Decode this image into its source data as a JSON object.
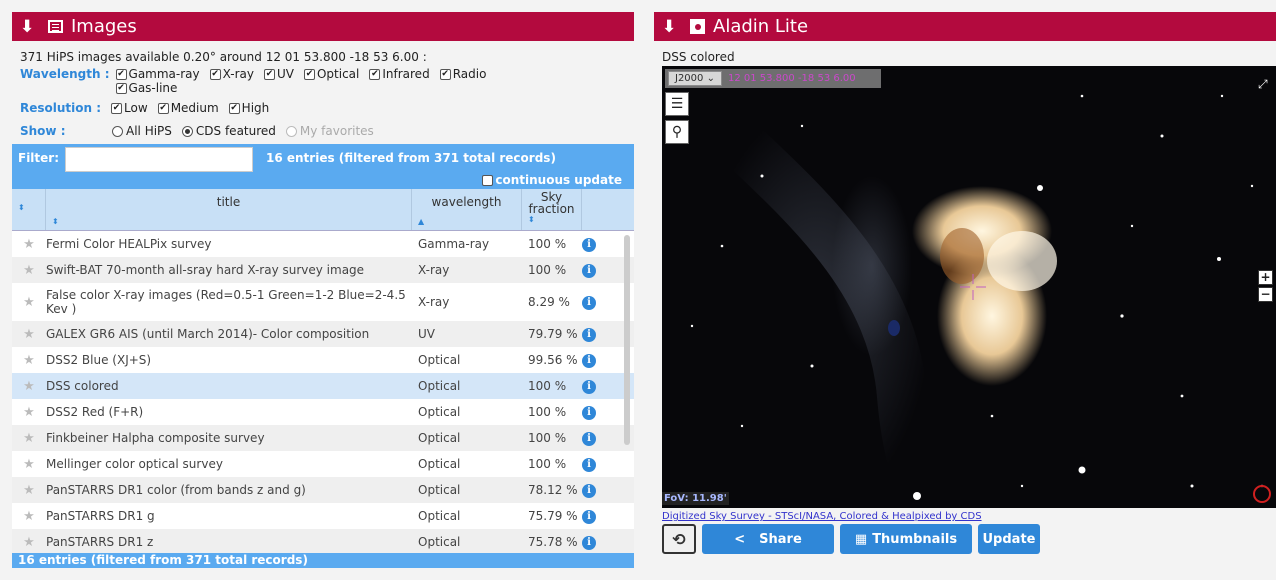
{
  "left_panel": {
    "title": "Images",
    "summary": "371 HiPS images available 0.20° around 12 01 53.800 -18 53 6.00 :",
    "wavelength_label": "Wavelength :",
    "wavelengths": [
      "Gamma-ray",
      "X-ray",
      "UV",
      "Optical",
      "Infrared",
      "Radio",
      "Gas-line"
    ],
    "resolution_label": "Resolution :",
    "resolutions": [
      "Low",
      "Medium",
      "High"
    ],
    "show_label": "Show :",
    "show_options": [
      "All HiPS",
      "CDS featured",
      "My favorites"
    ],
    "show_selected": "CDS featured",
    "filter_label": "Filter:",
    "filter_value": "",
    "entries_count": "16 entries (filtered from 371 total records)",
    "continuous_update": "continuous update",
    "columns": {
      "title": "title",
      "wavelength": "wavelength",
      "sky1": "Sky",
      "sky2": "fraction"
    },
    "rows": [
      {
        "title": "Fermi Color HEALPix survey",
        "wavelength": "Gamma-ray",
        "sky": "100 %"
      },
      {
        "title": "Swift-BAT 70-month all-sray hard X-ray survey image",
        "wavelength": "X-ray",
        "sky": "100 %"
      },
      {
        "title": "False color X-ray images (Red=0.5-1 Green=1-2 Blue=2-4.5 Kev )",
        "wavelength": "X-ray",
        "sky": "8.29 %"
      },
      {
        "title": "GALEX GR6 AIS (until March 2014)- Color composition",
        "wavelength": "UV",
        "sky": "79.79 %"
      },
      {
        "title": "DSS2 Blue (XJ+S)",
        "wavelength": "Optical",
        "sky": "99.56 %"
      },
      {
        "title": "DSS colored",
        "wavelength": "Optical",
        "sky": "100 %"
      },
      {
        "title": "DSS2 Red (F+R)",
        "wavelength": "Optical",
        "sky": "100 %"
      },
      {
        "title": "Finkbeiner Halpha composite survey",
        "wavelength": "Optical",
        "sky": "100 %"
      },
      {
        "title": "Mellinger color optical survey",
        "wavelength": "Optical",
        "sky": "100 %"
      },
      {
        "title": "PanSTARRS DR1 color (from bands z and g)",
        "wavelength": "Optical",
        "sky": "78.12 %"
      },
      {
        "title": "PanSTARRS DR1 g",
        "wavelength": "Optical",
        "sky": "75.79 %"
      },
      {
        "title": "PanSTARRS DR1 z",
        "wavelength": "Optical",
        "sky": "75.78 %"
      }
    ],
    "footer": "16 entries (filtered from 371 total records)"
  },
  "right_panel": {
    "title": "Aladin Lite",
    "survey_name": "DSS colored",
    "frame": "J2000",
    "coords": "12 01 53.800 -18 53 6.00",
    "fov": "FoV: 11.98'",
    "credits": "Digitized Sky Survey - STScI/NASA, Colored & Healpixed by CDS",
    "buttons": {
      "share": "Share",
      "thumbnails": "Thumbnails",
      "update": "Update"
    }
  },
  "colors": {
    "header": "#b30a3e",
    "accent": "#2f87d8",
    "filterbar": "#5aaaf0"
  }
}
